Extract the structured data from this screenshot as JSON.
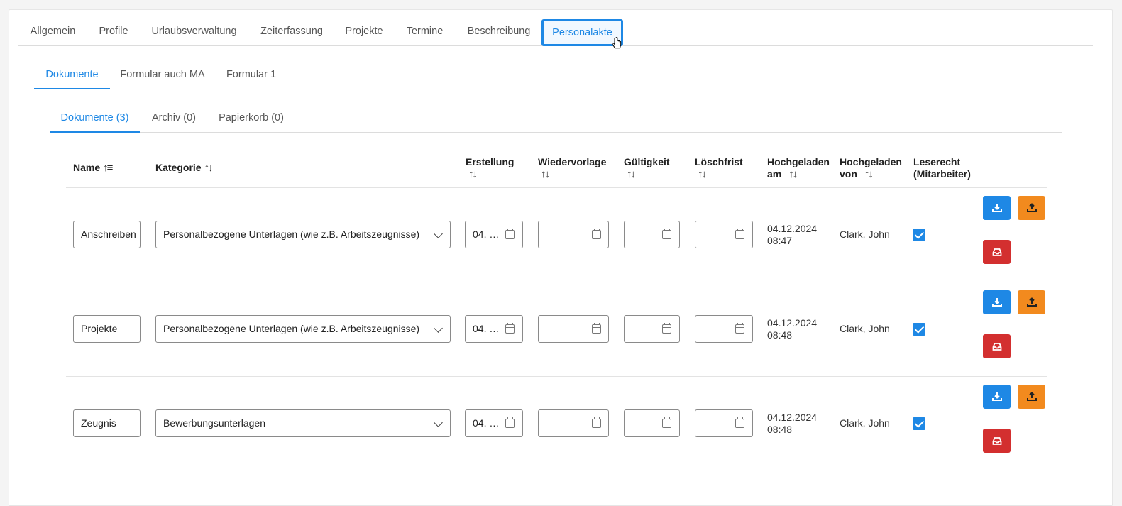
{
  "main_tabs": [
    "Allgemein",
    "Profile",
    "Urlaubsverwaltung",
    "Zeiterfassung",
    "Projekte",
    "Termine",
    "Beschreibung",
    "Personalakte"
  ],
  "sub_tabs": [
    "Dokumente",
    "Formular auch MA",
    "Formular 1"
  ],
  "doc_tabs": [
    "Dokumente (3)",
    "Archiv (0)",
    "Papierkorb (0)"
  ],
  "columns": {
    "name": "Name",
    "kategorie": "Kategorie",
    "erstellung": "Erstellung",
    "wiedervorlage": "Wiedervorlage",
    "gueltigkeit": "Gültigkeit",
    "loeschfrist": "Löschfrist",
    "hochgeladen_am_1": "Hochgeladen",
    "hochgeladen_am_2": "am",
    "hochgeladen_von_1": "Hochgeladen",
    "hochgeladen_von_2": "von",
    "leserecht_1": "Leserecht",
    "leserecht_2": "(Mitarbeiter)"
  },
  "rows": [
    {
      "name": "Anschreiben",
      "kategorie": "Personalbezogene Unterlagen (wie z.B. Arbeitszeugnisse)",
      "erstellung": "04. …",
      "wiedervorlage": "",
      "gueltigkeit": "",
      "loeschfrist": "",
      "uploaded_date": "04.12.2024",
      "uploaded_time": "08:47",
      "uploaded_by": "Clark, John",
      "leserecht": true
    },
    {
      "name": "Projekte",
      "kategorie": "Personalbezogene Unterlagen (wie z.B. Arbeitszeugnisse)",
      "erstellung": "04. …",
      "wiedervorlage": "",
      "gueltigkeit": "",
      "loeschfrist": "",
      "uploaded_date": "04.12.2024",
      "uploaded_time": "08:48",
      "uploaded_by": "Clark, John",
      "leserecht": true
    },
    {
      "name": "Zeugnis",
      "kategorie": "Bewerbungsunterlagen",
      "erstellung": "04. …",
      "wiedervorlage": "",
      "gueltigkeit": "",
      "loeschfrist": "",
      "uploaded_date": "04.12.2024",
      "uploaded_time": "08:48",
      "uploaded_by": "Clark, John",
      "leserecht": true
    }
  ],
  "icons": {
    "download": "download-icon",
    "upload": "upload-icon",
    "archive": "inbox-archive-icon",
    "calendar": "calendar-icon",
    "sort": "sort-icon"
  },
  "colors": {
    "accent": "#1e88e5",
    "orange": "#f28a1e",
    "red": "#d32f2f"
  }
}
